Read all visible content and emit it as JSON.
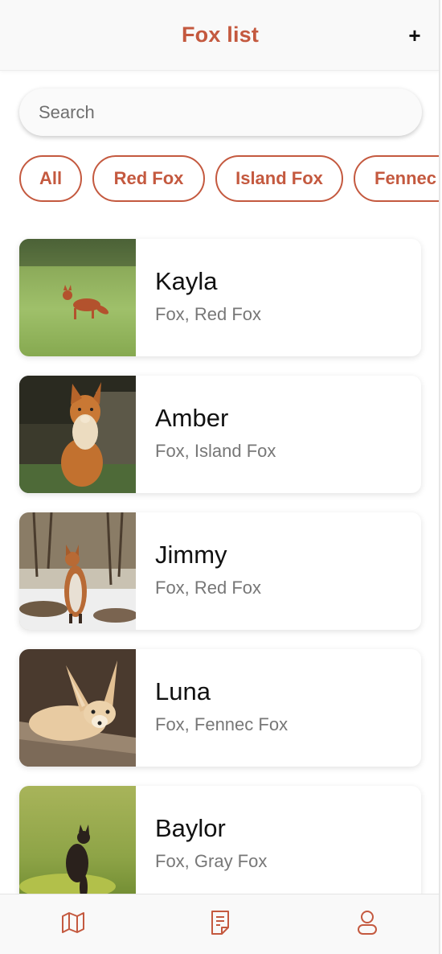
{
  "header": {
    "title": "Fox list",
    "add_label": "+"
  },
  "search": {
    "placeholder": "Search",
    "value": ""
  },
  "filters": [
    {
      "label": "All"
    },
    {
      "label": "Red Fox"
    },
    {
      "label": "Island Fox"
    },
    {
      "label": "Fennec"
    }
  ],
  "foxes": [
    {
      "name": "Kayla",
      "tags": "Fox, Red Fox"
    },
    {
      "name": "Amber",
      "tags": "Fox, Island Fox"
    },
    {
      "name": "Jimmy",
      "tags": "Fox, Red Fox"
    },
    {
      "name": "Luna",
      "tags": "Fox, Fennec Fox"
    },
    {
      "name": "Baylor",
      "tags": "Fox, Gray Fox"
    }
  ],
  "bottom_nav": {
    "items": [
      {
        "icon": "map-icon"
      },
      {
        "icon": "list-icon"
      },
      {
        "icon": "profile-icon"
      }
    ]
  },
  "colors": {
    "accent": "#c4593f",
    "icon": "#c4593f"
  }
}
